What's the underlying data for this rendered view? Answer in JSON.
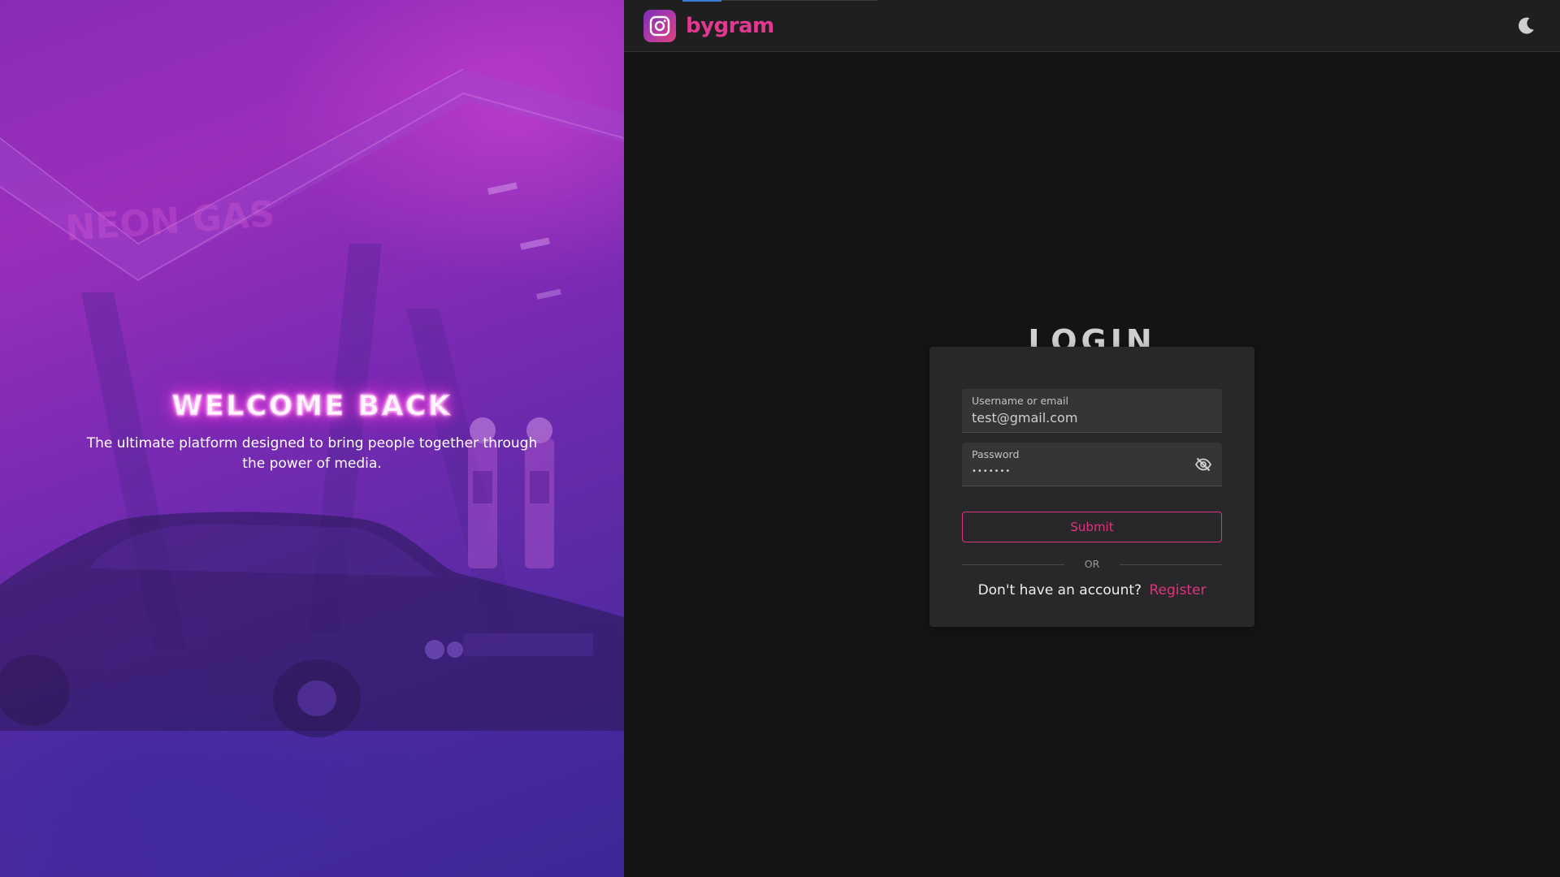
{
  "colors": {
    "accent": "#e0337f",
    "background": "#141414",
    "topbar": "#1f1f20",
    "card": "#28282a",
    "field": "#353537",
    "hero_purple": "#8a2bb7",
    "progress": "#3a7bd5"
  },
  "hero": {
    "sign_text": "NEON GAS",
    "title": "WELCOME BACK",
    "subtitle": "The ultimate platform designed to bring people together through the power of media."
  },
  "header": {
    "brand_name": "bygram",
    "logo_icon": "instagram-camera-icon",
    "theme_icon": "moon-icon"
  },
  "login": {
    "title": "LOGIN",
    "username": {
      "label": "Username or email",
      "value": "test@gmail.com"
    },
    "password": {
      "label": "Password",
      "value": "•••••••",
      "toggle_icon": "eye-off-icon"
    },
    "submit_label": "Submit",
    "divider_label": "OR",
    "no_account_text": "Don't have an account?",
    "register_label": "Register"
  }
}
